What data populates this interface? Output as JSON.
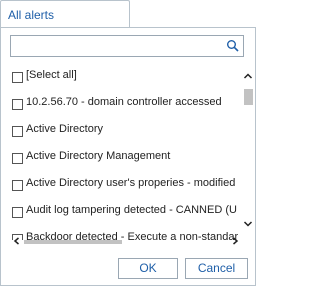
{
  "tab": {
    "label": "All alerts"
  },
  "search": {
    "value": "",
    "placeholder": ""
  },
  "list": {
    "items": [
      {
        "label": "[Select all]",
        "checked": false
      },
      {
        "label": "10.2.56.70 - domain controller accessed",
        "checked": false
      },
      {
        "label": "Active Directory",
        "checked": false
      },
      {
        "label": "Active Directory Management",
        "checked": false
      },
      {
        "label": "Active Directory user's properies - modified",
        "checked": false
      },
      {
        "label": "Audit log tampering detected - CANNED (U",
        "checked": false
      },
      {
        "label": "Backdoor detected - Execute a non-standar",
        "checked": false
      }
    ]
  },
  "buttons": {
    "ok_label": "OK",
    "cancel_label": "Cancel"
  }
}
